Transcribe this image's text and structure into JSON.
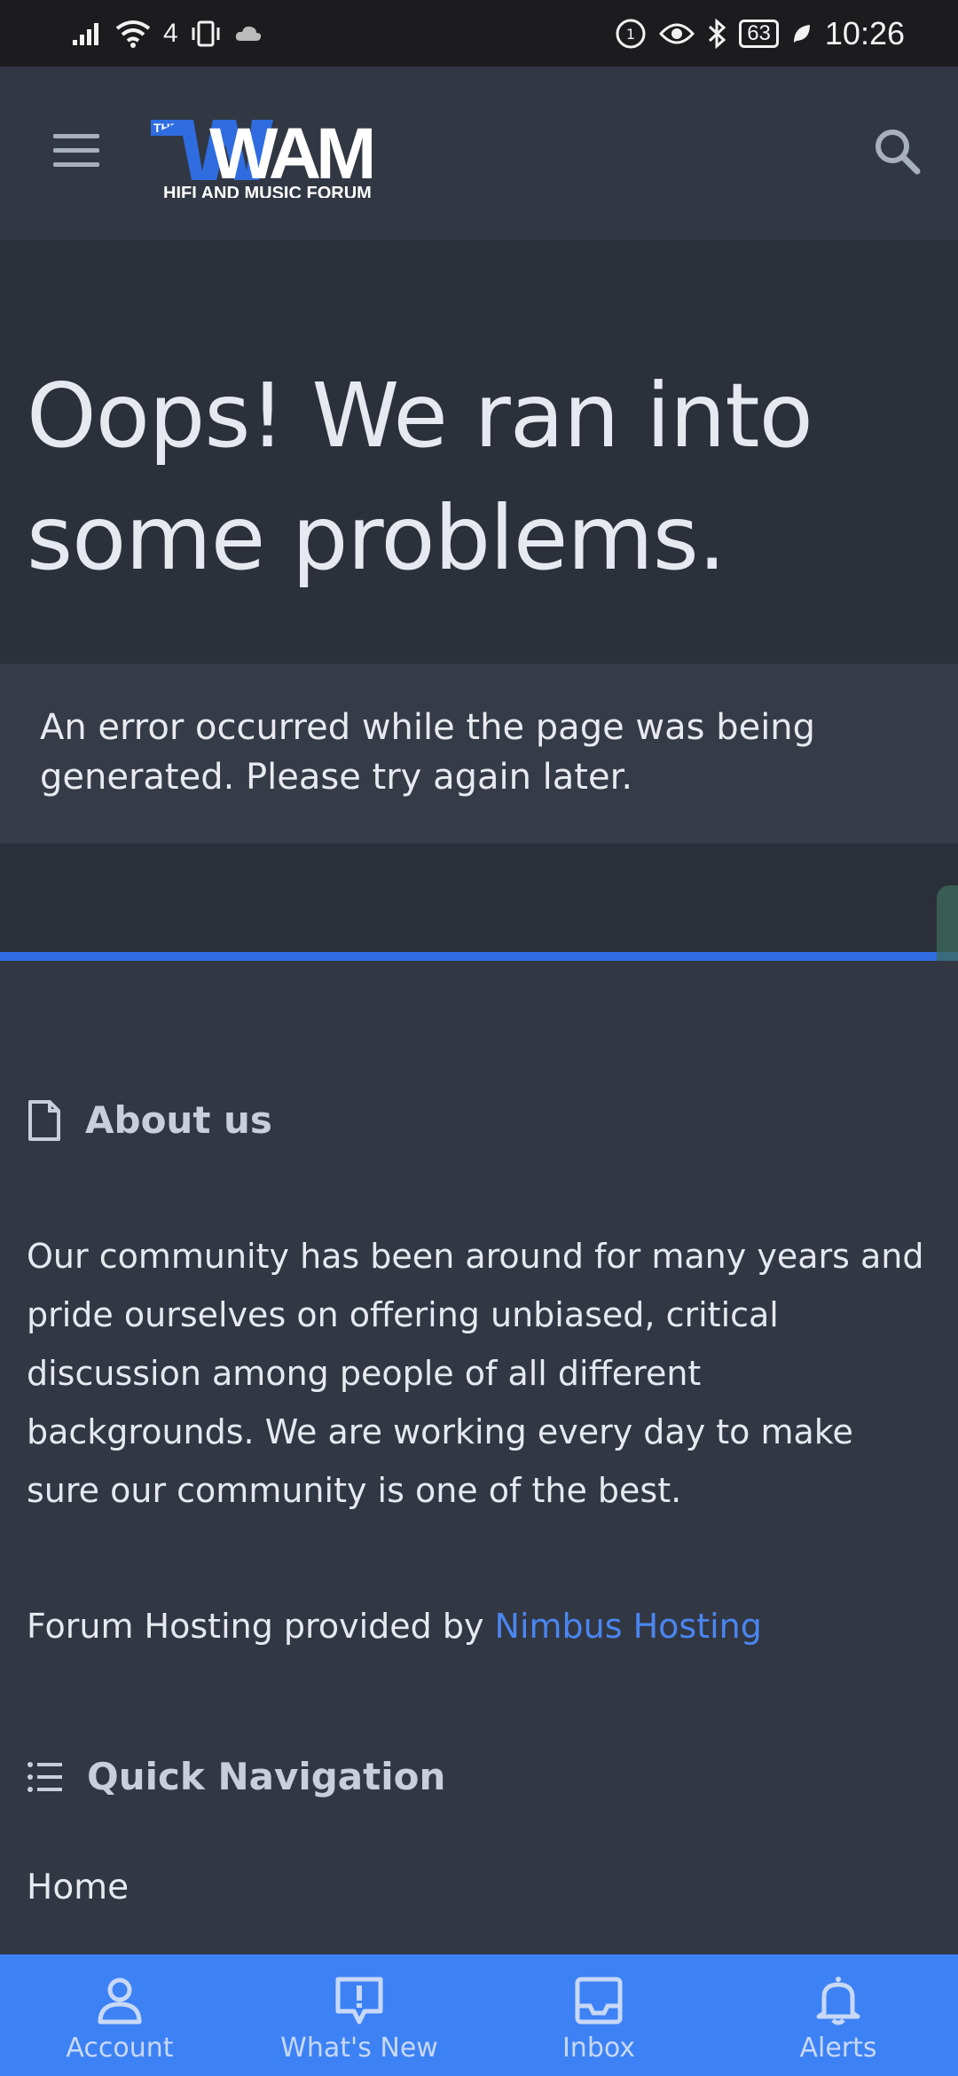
{
  "status_bar": {
    "network": "4",
    "battery": "63",
    "time": "10:26"
  },
  "header": {
    "logo_the": "THE",
    "logo_main": "WAM",
    "logo_subtitle": "HIFI AND MUSIC FORUM"
  },
  "hero": {
    "title": "Oops! We ran into some problems."
  },
  "error": {
    "message": "An error occurred while the page was being generated. Please try again later."
  },
  "about": {
    "title": "About us",
    "text": "Our community has been around for many years and pride ourselves on offering unbiased, critical discussion among people of all different backgrounds. We are working every day to make sure our community is one of the best.",
    "hosting_prefix": "Forum Hosting provided by ",
    "hosting_link": "Nimbus Hosting"
  },
  "quick_nav": {
    "title": "Quick Navigation",
    "items": [
      {
        "label": "Home"
      }
    ]
  },
  "bottom_nav": {
    "items": [
      {
        "label": "Account",
        "icon": "account-icon"
      },
      {
        "label": "What's New",
        "icon": "whats-new-icon"
      },
      {
        "label": "Inbox",
        "icon": "inbox-icon"
      },
      {
        "label": "Alerts",
        "icon": "bell-icon"
      }
    ]
  },
  "colors": {
    "header_bg": "#323744",
    "accent": "#2f6ce0",
    "link": "#4a86f0",
    "bottom_nav_bg": "#3d82f5"
  }
}
